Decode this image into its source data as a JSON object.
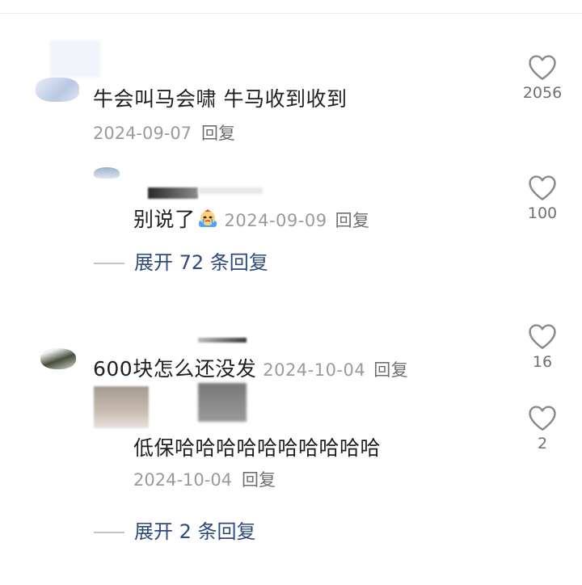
{
  "comments": [
    {
      "text": "牛会叫马会啸 牛马收到收到",
      "date": "2024-09-07",
      "reply_label": "回复",
      "likes": "2056"
    },
    {
      "text": "别说了",
      "date": "2024-09-09",
      "reply_label": "回复",
      "likes": "100",
      "emoji": "crying-face-emoji",
      "expand_label": "展开 72 条回复"
    },
    {
      "text": "600块怎么还没发",
      "date": "2024-10-04",
      "reply_label": "回复",
      "likes": "16"
    },
    {
      "text": "低保哈哈哈哈哈哈哈哈哈哈",
      "date": "2024-10-04",
      "reply_label": "回复",
      "likes": "2",
      "expand_label": "展开 2 条回复"
    }
  ],
  "icons": {
    "like": "heart-outline-icon"
  },
  "colors": {
    "link": "#2d4a7a",
    "meta": "#9a9a9a",
    "icon": "#8a8a8a"
  }
}
